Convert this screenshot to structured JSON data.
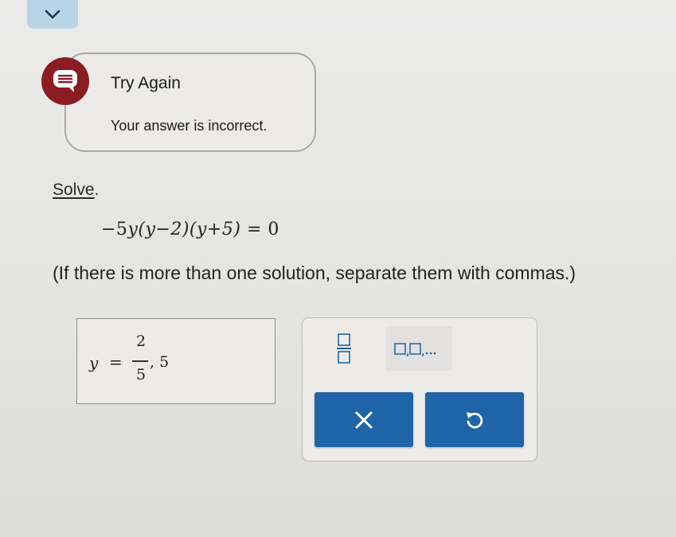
{
  "feedback": {
    "title": "Try Again",
    "message": "Your answer is incorrect."
  },
  "problem": {
    "directive": "Solve",
    "directive_suffix": ".",
    "equation": {
      "coef": "−5",
      "var": "y",
      "factor1": "(y−2)",
      "factor2": "(y+5)",
      "rhs": "= 0"
    },
    "instruction": "(If there is more than one solution, separate them with commas.)"
  },
  "answer": {
    "variable": "y",
    "equals": "=",
    "fraction_numerator": "2",
    "fraction_denominator": "5",
    "rest": ", 5"
  },
  "colors": {
    "accent": "#1f64a6",
    "error": "#8b1c22",
    "tab": "#b9d4e6"
  },
  "icons": {
    "collapse": "chevron-down-icon",
    "feedback": "chat-bubble-icon",
    "fraction_tool": "fraction-template-icon",
    "list_tool": "comma-list-template-icon",
    "clear": "x-icon",
    "undo": "undo-icon"
  }
}
